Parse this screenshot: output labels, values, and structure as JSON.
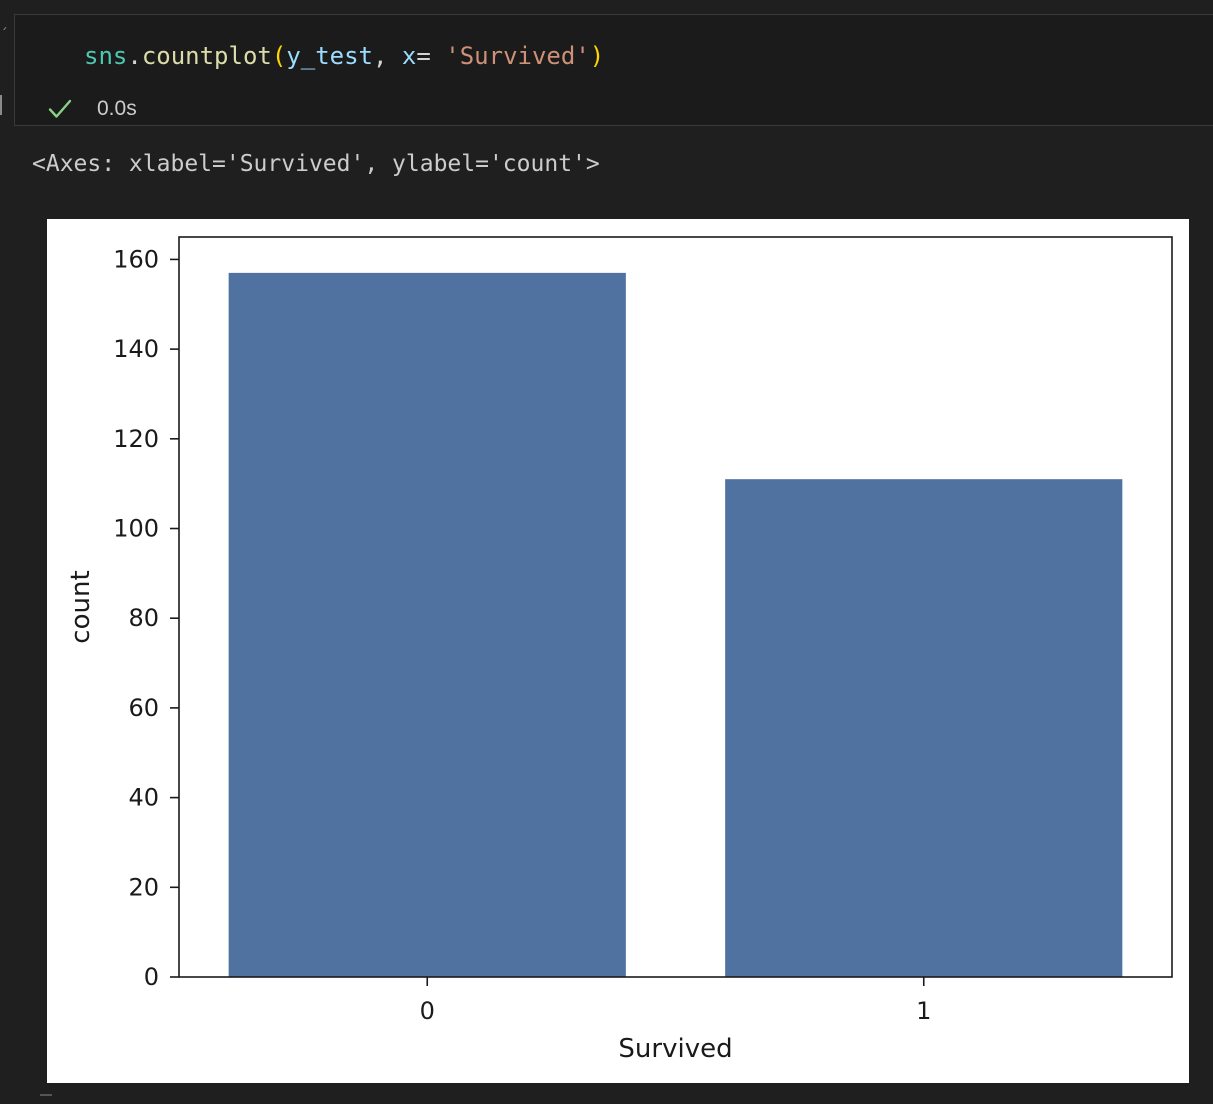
{
  "cell": {
    "code_tokens": [
      {
        "text": "sns",
        "cls": "tok-sns"
      },
      {
        "text": ".",
        "cls": "tok-plain"
      },
      {
        "text": "countplot",
        "cls": "tok-fn"
      },
      {
        "text": "(",
        "cls": "tok-paren"
      },
      {
        "text": "y_test",
        "cls": "tok-var"
      },
      {
        "text": ", ",
        "cls": "tok-plain"
      },
      {
        "text": "x",
        "cls": "tok-var"
      },
      {
        "text": "= ",
        "cls": "tok-plain"
      },
      {
        "text": "'Survived'",
        "cls": "tok-str"
      },
      {
        "text": ")",
        "cls": "tok-paren"
      }
    ],
    "status_icon": "checkmark-icon",
    "exec_time": "0.0s"
  },
  "output": {
    "text": "<Axes: xlabel='Survived', ylabel='count'>"
  },
  "chart_data": {
    "type": "bar",
    "categories": [
      "0",
      "1"
    ],
    "values": [
      157,
      111
    ],
    "title": "",
    "xlabel": "Survived",
    "ylabel": "count",
    "ylim": [
      0,
      165
    ],
    "yticks": [
      0,
      20,
      40,
      60,
      80,
      100,
      120,
      140,
      160
    ],
    "bar_color": "#4f72a0",
    "grid": false
  },
  "colors": {
    "background": "#1f1f1f",
    "cell_background": "#1b1b1b",
    "success_check": "#89d185"
  }
}
